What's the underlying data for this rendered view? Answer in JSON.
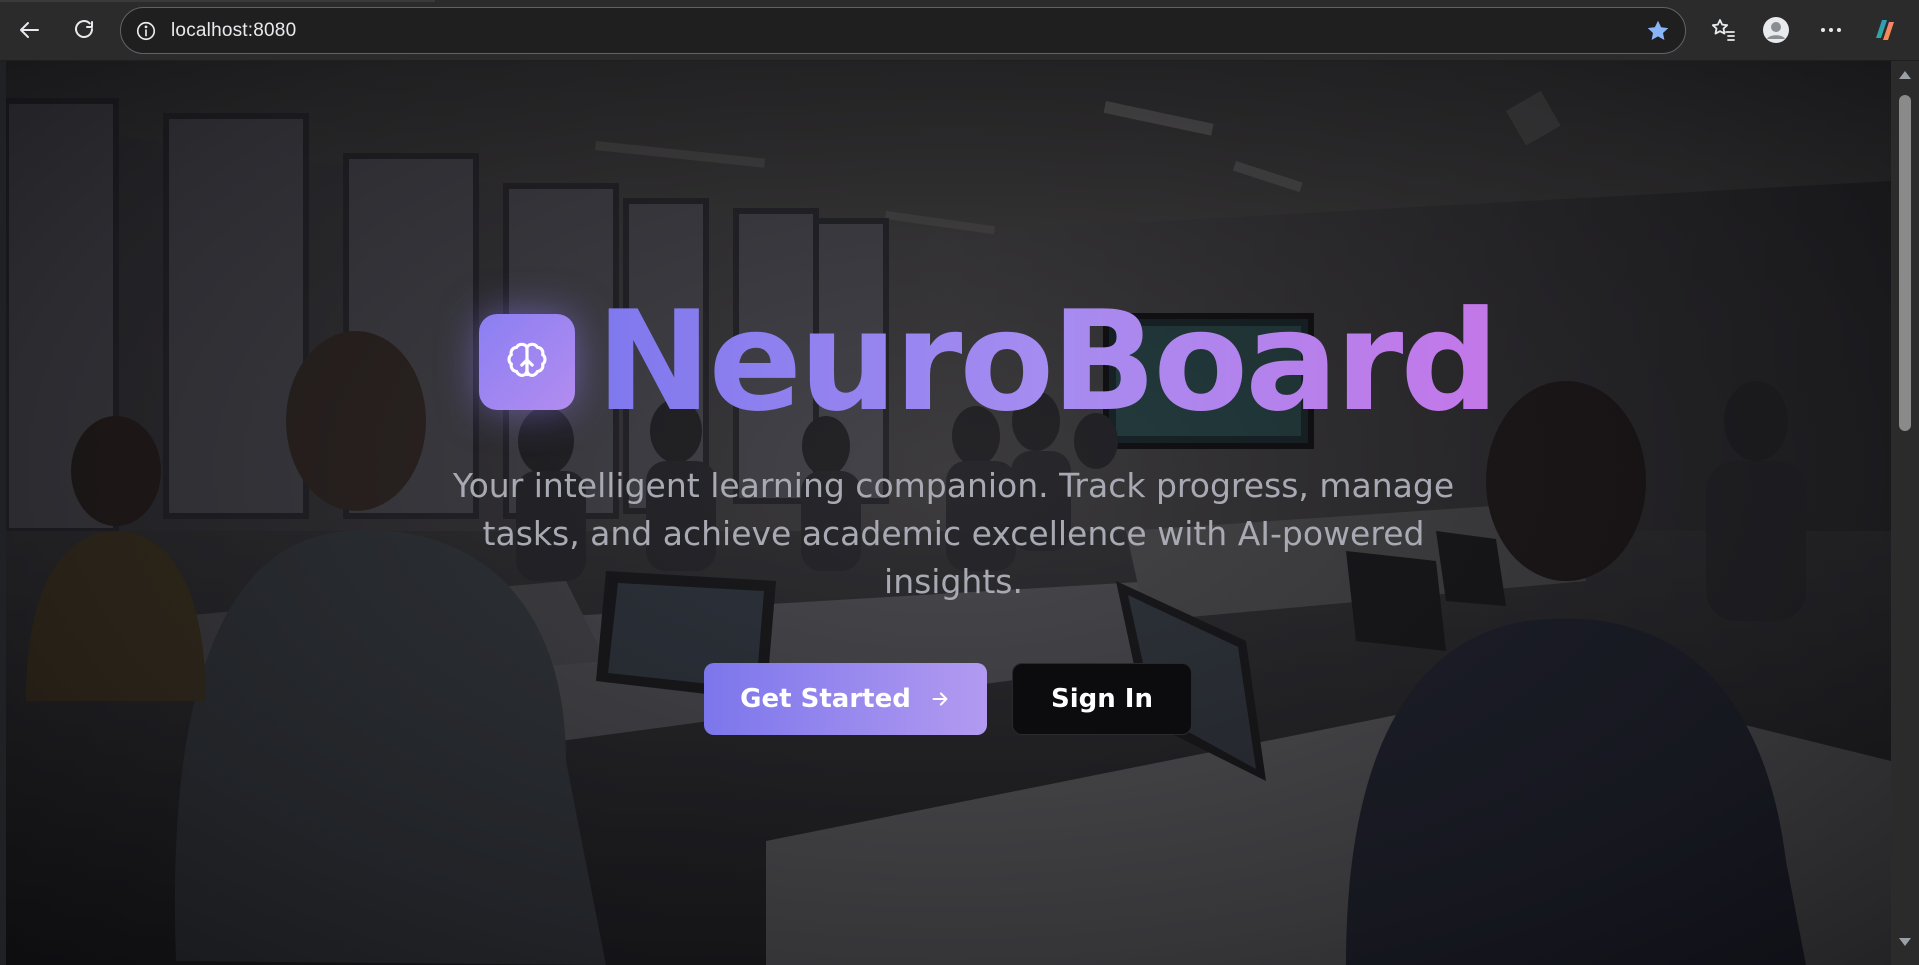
{
  "browser": {
    "url": "localhost:8080",
    "icons": {
      "back": "arrow-left-icon",
      "reload": "reload-icon",
      "site_info": "info-icon",
      "bookmark": "star-icon",
      "favorites": "favorites-list-icon",
      "profile": "profile-avatar-icon",
      "more": "more-dots-icon",
      "copilot": "copilot-icon"
    },
    "bookmark_color": "#8ab4f8"
  },
  "hero": {
    "logo_icon": "brain-icon",
    "title": "NeuroBoard",
    "tagline": "Your intelligent learning companion. Track progress, manage tasks, and achieve academic excellence with AI-powered insights.",
    "primary_button": {
      "label": "Get Started",
      "icon": "arrow-right-icon"
    },
    "secondary_button": {
      "label": "Sign In"
    }
  },
  "colors": {
    "accent_start": "#7c76ec",
    "accent_end": "#c477e8",
    "secondary_button_bg": "#0c0c0f"
  }
}
